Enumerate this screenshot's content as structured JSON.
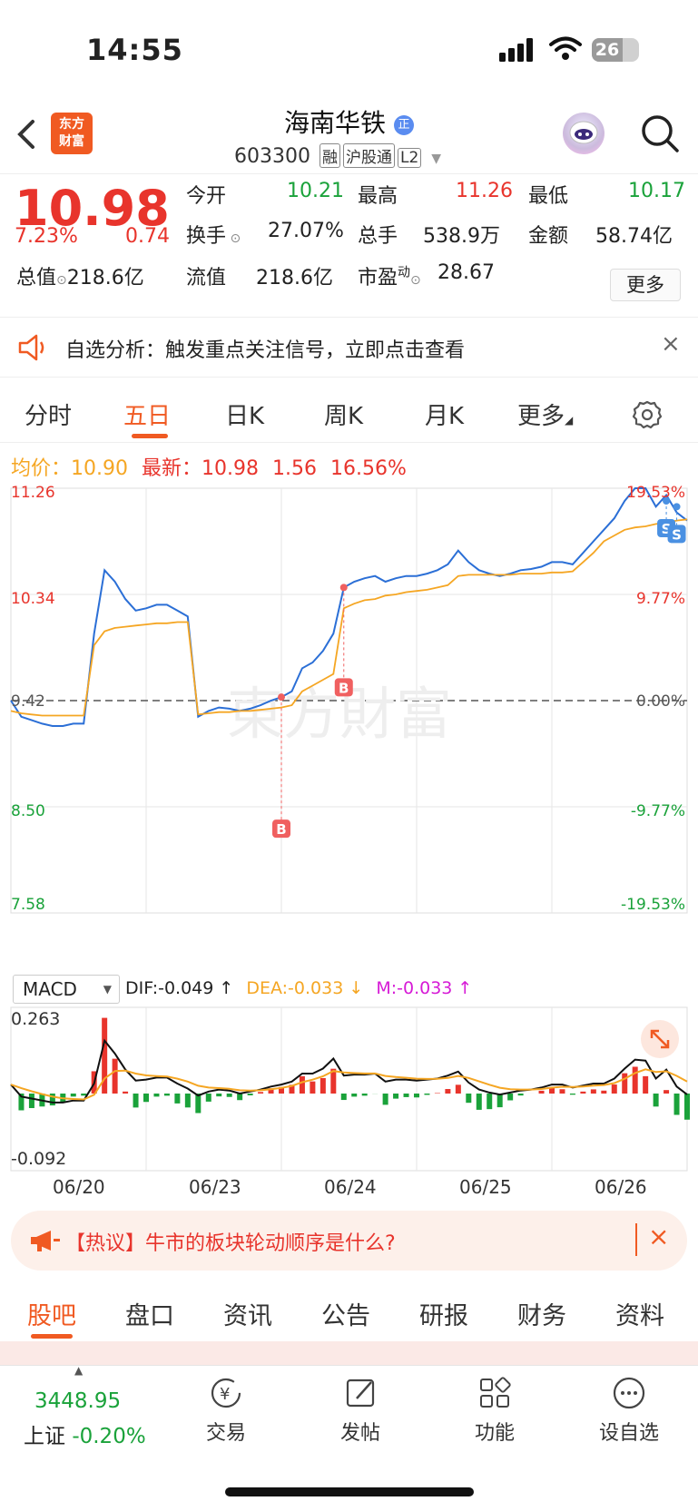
{
  "status": {
    "time": "14:55",
    "battery": "26"
  },
  "nav": {
    "logo_line1": "东方",
    "logo_line2": "财富",
    "name": "海南华铁",
    "badge": "正",
    "code": "603300",
    "tags": [
      "融",
      "沪股通",
      "L2"
    ]
  },
  "quote": {
    "price": "10.98",
    "pct": "7.23%",
    "change": "0.74",
    "open_label": "今开",
    "open": "10.21",
    "high_label": "最高",
    "high": "11.26",
    "low_label": "最低",
    "low": "10.17",
    "turnover_label": "换手",
    "turnover": "27.07%",
    "vol_label": "总手",
    "vol": "538.9万",
    "amount_label": "金额",
    "amount": "58.74亿",
    "mcap_label": "总值",
    "mcap": "218.6亿",
    "float_label": "流值",
    "float": "218.6亿",
    "pe_label": "市盈",
    "pe_sup": "动",
    "pe": "28.67",
    "more": "更多"
  },
  "alert": {
    "text": "自选分析：触发重点关注信号，立即点击查看"
  },
  "tabs": [
    "分时",
    "五日",
    "日K",
    "周K",
    "月K",
    "更多"
  ],
  "avg_bar": {
    "avg_label": "均价：",
    "avg": "10.90",
    "latest_label": "最新：",
    "latest": "10.98",
    "chg": "1.56",
    "pct": "16.56%"
  },
  "chart_data": {
    "type": "line",
    "y_left": [
      "11.26",
      "10.34",
      "9.42",
      "8.50",
      "7.58"
    ],
    "y_right": [
      "19.53%",
      "9.77%",
      "0.00%",
      "-9.77%",
      "-19.53%"
    ],
    "ylim": [
      7.58,
      11.26
    ],
    "prev_close": 9.42,
    "days": [
      "06/20",
      "06/23",
      "06/24",
      "06/25",
      "06/26"
    ],
    "series": [
      {
        "values": [
          9.42,
          9.28,
          9.25,
          9.22,
          9.2,
          9.2,
          9.22,
          9.22,
          10.0,
          10.55,
          10.45,
          10.3,
          10.2,
          10.22,
          10.25,
          10.25,
          10.2,
          10.15,
          9.28,
          9.33,
          9.36,
          9.35,
          9.33,
          9.35,
          9.38,
          9.42,
          9.45,
          9.5,
          9.7,
          9.75,
          9.85,
          10.0,
          10.4,
          10.45,
          10.48,
          10.5,
          10.45,
          10.48,
          10.5,
          10.5,
          10.52,
          10.55,
          10.6,
          10.72,
          10.62,
          10.55,
          10.52,
          10.5,
          10.52,
          10.55,
          10.56,
          10.58,
          10.62,
          10.62,
          10.6,
          10.7,
          10.8,
          10.9,
          11.0,
          11.15,
          11.26,
          11.26,
          11.1,
          11.2,
          11.05,
          10.98
        ]
      },
      {
        "values": [
          9.33,
          9.31,
          9.3,
          9.29,
          9.29,
          9.29,
          9.29,
          9.29,
          9.9,
          10.02,
          10.05,
          10.06,
          10.07,
          10.08,
          10.09,
          10.09,
          10.1,
          10.1,
          9.3,
          9.31,
          9.32,
          9.32,
          9.33,
          9.33,
          9.34,
          9.35,
          9.36,
          9.38,
          9.5,
          9.55,
          9.6,
          9.65,
          10.22,
          10.26,
          10.29,
          10.3,
          10.33,
          10.34,
          10.36,
          10.37,
          10.38,
          10.4,
          10.42,
          10.5,
          10.51,
          10.51,
          10.51,
          10.51,
          10.51,
          10.52,
          10.52,
          10.52,
          10.53,
          10.53,
          10.54,
          10.62,
          10.7,
          10.8,
          10.85,
          10.9,
          10.92,
          10.93,
          10.95,
          10.96,
          10.98,
          10.99
        ]
      }
    ],
    "markers": [
      "B",
      "B",
      "S",
      "S"
    ]
  },
  "macd": {
    "name": "MACD",
    "dif": "DIF:-0.049",
    "dea": "DEA:-0.033",
    "m": "M:-0.033",
    "top": "0.263",
    "bottom": "-0.092"
  },
  "hot": {
    "text": "【热议】牛市的板块轮动顺序是什么?"
  },
  "bottom_tabs": [
    "股吧",
    "盘口",
    "资讯",
    "公告",
    "研报",
    "财务",
    "资料"
  ],
  "bottom_bar": {
    "index_value": "3448.95",
    "index_name": "上证",
    "index_pct": "-0.20%",
    "items": [
      "交易",
      "发帖",
      "功能",
      "设自选"
    ]
  }
}
